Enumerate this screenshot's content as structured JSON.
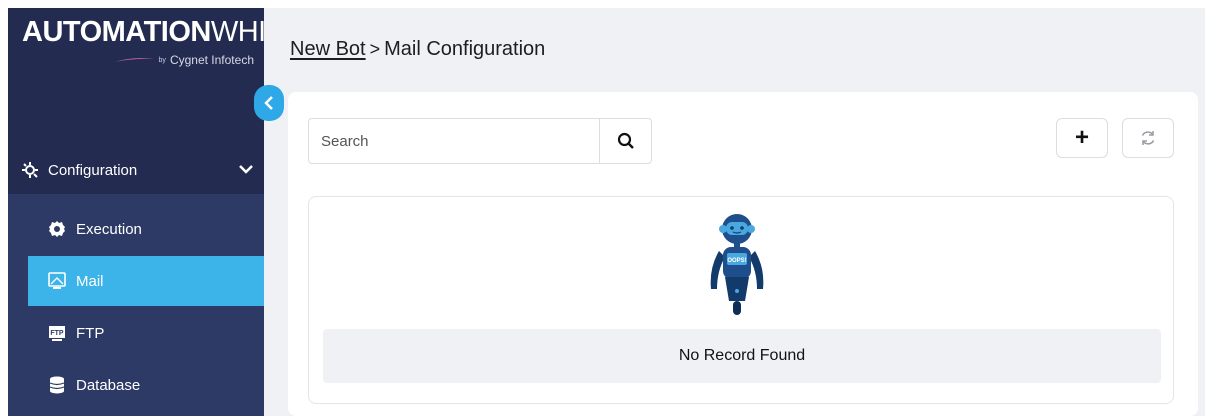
{
  "brand": {
    "name_bold": "AUTOMATION",
    "name_light": "WHIZ",
    "by": "by",
    "company": "Cygnet Infotech"
  },
  "sidebar": {
    "section": {
      "label": "Configuration",
      "icon": "config-icon",
      "expanded": true
    },
    "items": [
      {
        "label": "Execution",
        "icon": "gear-icon",
        "active": false
      },
      {
        "label": "Mail",
        "icon": "mail-icon",
        "active": true
      },
      {
        "label": "FTP",
        "icon": "ftp-icon",
        "active": false
      },
      {
        "label": "Database",
        "icon": "database-icon",
        "active": false
      }
    ]
  },
  "breadcrumb": {
    "parent": "New Bot",
    "separator": ">",
    "current": "Mail Configuration"
  },
  "toolbar": {
    "search_placeholder": "Search",
    "search_value": "",
    "add_label": "+",
    "refresh_icon": "refresh-icon"
  },
  "empty_state": {
    "badge": "OOPS!",
    "message": "No Record Found"
  },
  "colors": {
    "sidebar_bg": "#232b50",
    "subnav_bg": "#2e3a66",
    "active_bg": "#3cb3e9",
    "accent": "#2ea8e6",
    "main_bg": "#f0f1f5"
  }
}
